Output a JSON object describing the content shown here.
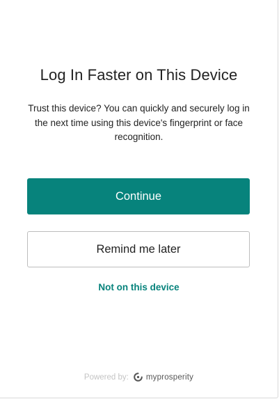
{
  "dialog": {
    "title": "Log In Faster on This Device",
    "description": "Trust this device? You can quickly and securely log in the next time using this device's fingerprint or face recognition.",
    "continue_label": "Continue",
    "remind_label": "Remind me later",
    "not_device_label": "Not on this device"
  },
  "footer": {
    "powered_by": "Powered by:",
    "brand_icon": "myprosperity-logo-icon",
    "brand_name": "myprosperity"
  },
  "colors": {
    "accent": "#07837c",
    "text": "#222222",
    "muted": "#c4c4c4"
  }
}
